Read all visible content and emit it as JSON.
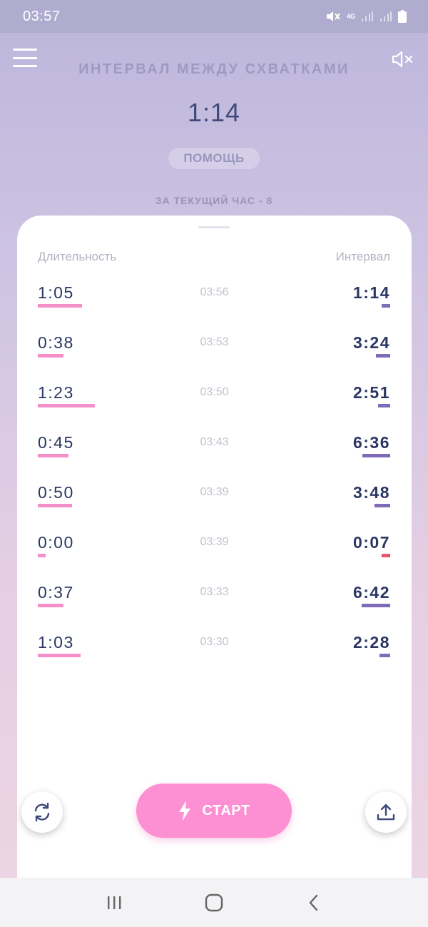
{
  "status_bar": {
    "time": "03:57",
    "network": "4G"
  },
  "header": {
    "title": "ИНТЕРВАЛ МЕЖДУ СХВАТКАМИ",
    "current_interval": "1:14",
    "help_label": "ПОМОЩЬ",
    "hour_count": "ЗА ТЕКУЩИЙ ЧАС - 8"
  },
  "table": {
    "duration_header": "Длительность",
    "interval_header": "Интервал",
    "rows": [
      {
        "duration": "1:05",
        "time": "03:56",
        "interval": "1:14",
        "interval_status": "normal"
      },
      {
        "duration": "0:38",
        "time": "03:53",
        "interval": "3:24",
        "interval_status": "normal"
      },
      {
        "duration": "1:23",
        "time": "03:50",
        "interval": "2:51",
        "interval_status": "normal"
      },
      {
        "duration": "0:45",
        "time": "03:43",
        "interval": "6:36",
        "interval_status": "normal"
      },
      {
        "duration": "0:50",
        "time": "03:39",
        "interval": "3:48",
        "interval_status": "normal"
      },
      {
        "duration": "0:00",
        "time": "03:39",
        "interval": "0:07",
        "interval_status": "alert"
      },
      {
        "duration": "0:37",
        "time": "03:33",
        "interval": "6:42",
        "interval_status": "normal"
      },
      {
        "duration": "1:03",
        "time": "03:30",
        "interval": "2:28",
        "interval_status": "normal"
      }
    ]
  },
  "actions": {
    "start_label": "СТАРТ",
    "reset_icon": "refresh-icon",
    "share_icon": "upload-icon"
  },
  "colors": {
    "duration_bar": "#f58fc9",
    "interval_bar": "#7f6bb8",
    "interval_alert": "#e8556a",
    "start_button": "#fd8fd3"
  }
}
